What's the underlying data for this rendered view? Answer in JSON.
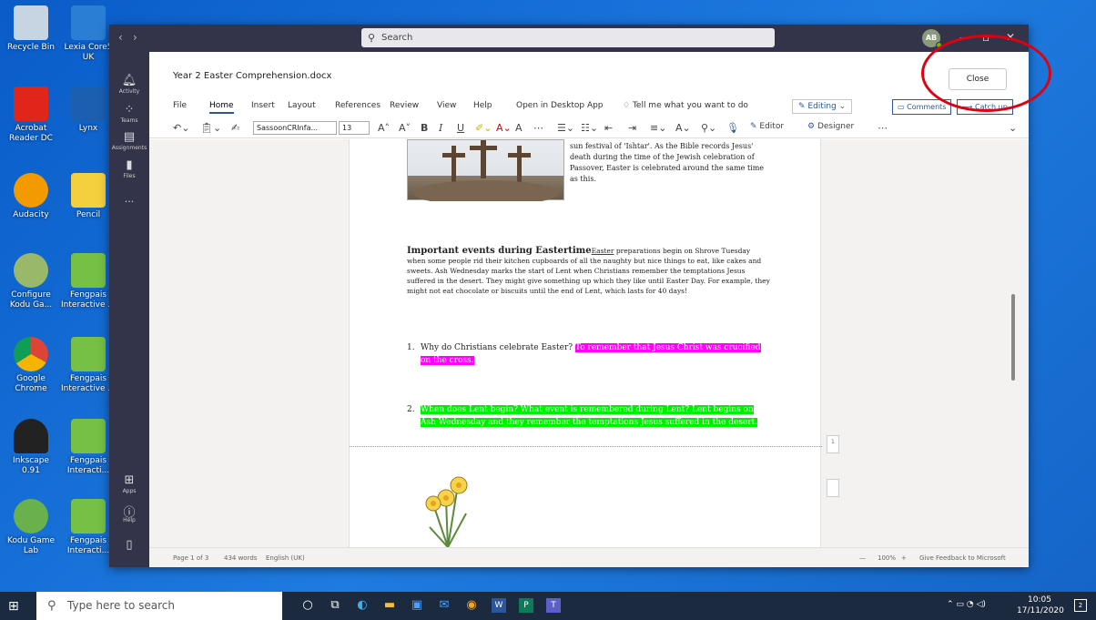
{
  "desktop": {
    "icons": [
      {
        "label": "Recycle Bin",
        "x": 0
      },
      {
        "label": "Lexia Core5 UK"
      },
      {
        "label": "Acrobat Reader DC"
      },
      {
        "label": "Lynx"
      },
      {
        "label": "Audacity"
      },
      {
        "label": "Pencil"
      },
      {
        "label": "Configure Kodu Ga..."
      },
      {
        "label": "Fengpais Interactive ..."
      },
      {
        "label": "Google Chrome"
      },
      {
        "label": "Fengpais Interactive ..."
      },
      {
        "label": "Inkscape 0.91"
      },
      {
        "label": "Fengpais Interacti..."
      },
      {
        "label": "Kodu Game Lab"
      },
      {
        "label": "Fengpais Interacti..."
      }
    ]
  },
  "teams": {
    "search_placeholder": "Search",
    "nav_back": "‹",
    "nav_forward": "›",
    "avatar_initials": "AB",
    "rail": [
      {
        "label": "Activity",
        "icon": "bell-icon"
      },
      {
        "label": "Teams",
        "icon": "teams-icon"
      },
      {
        "label": "Assignments",
        "icon": "assignments-icon"
      },
      {
        "label": "Files",
        "icon": "files-icon"
      },
      {
        "label": "...",
        "icon": "more-icon"
      },
      {
        "label": "Apps",
        "icon": "apps-icon"
      },
      {
        "label": "Help",
        "icon": "help-icon"
      },
      {
        "label": "",
        "icon": "device-icon"
      }
    ]
  },
  "document": {
    "title": "Year 2 Easter Comprehension.docx",
    "close_label": "Close",
    "menus": [
      "File",
      "Home",
      "Insert",
      "Layout",
      "References",
      "Review",
      "View",
      "Help",
      "Open in Desktop App"
    ],
    "tell_me": "Tell me what you want to do",
    "editing_label": "Editing",
    "comments_label": "Comments",
    "catchup_label": "Catch up",
    "font_name": "SassoonCRInfa...",
    "font_size": "13",
    "editor_label": "Editor",
    "designer_label": "Designer",
    "top_paragraph": "sun festival of 'Ishtar'. As the Bible records Jesus' death during the time of the Jewish celebration of Passover, Easter is celebrated around the same time as this.",
    "events_heading": "Important events during Eastertime",
    "events_first_word": "Easter",
    "events_body": " preparations begin on Shrove Tuesday when some people rid their kitchen cupboards of all the naughty but nice things to eat, like cakes and sweets. Ash Wednesday marks the start of Lent when Christians remember the temptations Jesus suffered in the desert. They might give something up which they like until Easter Day. For example, they might not eat chocolate or biscuits until the end of Lent, which lasts for 40 days!",
    "q1_num": "1.",
    "q1_question": "Why do Christians celebrate Easter?",
    "q1_answer": "To remember that Jesus Christ was crucified on the cross.",
    "q2_num": "2.",
    "q2_text": "When does Lent begin? What event is remembered during Lent? Lent begins on Ash Wednesday and they remember the temptations Jesus suffered in the desert.",
    "side_page_number": "1"
  },
  "status": {
    "page": "Page 1 of 3",
    "words": "434 words",
    "language": "English (UK)",
    "zoom": "100%",
    "feedback": "Give Feedback to Microsoft"
  },
  "taskbar": {
    "search_placeholder": "Type here to search",
    "time": "10:05",
    "date": "17/11/2020",
    "notifications": "2"
  }
}
